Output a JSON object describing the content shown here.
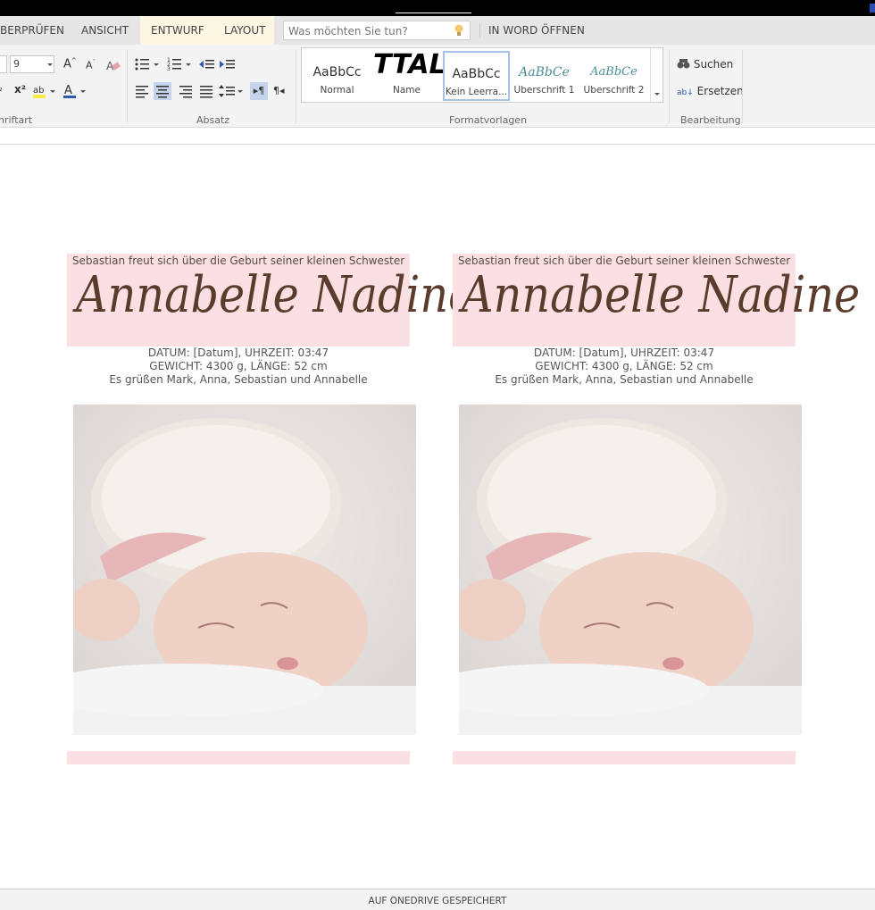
{
  "tabs": {
    "review": "ÜBERPRÜFEN",
    "view": "ANSICHT",
    "design": "ENTWURF",
    "layout": "LAYOUT",
    "open_in_word": "IN WORD ÖFFNEN"
  },
  "tell_me": {
    "placeholder": "Was möchten Sie tun?"
  },
  "ribbon": {
    "font_size": "9",
    "font_group_label": "Schriftart",
    "paragraph_group_label": "Absatz",
    "styles_group_label": "Formatvorlagen",
    "editing_group_label": "Bearbeitung",
    "styles": [
      {
        "preview": "AaBbCc",
        "label": "Normal"
      },
      {
        "preview": "TTAL",
        "label": "Name"
      },
      {
        "preview": "AaBbCc",
        "label": "Kein Leerra..."
      },
      {
        "preview": "AaBbCe",
        "label": "Überschrift 1"
      },
      {
        "preview": "AaBbCe",
        "label": "Überschrift 2"
      }
    ],
    "find_label": "Suchen",
    "replace_label": "Ersetzen",
    "font_group_partial": "hriftart",
    "review_partial": "BERPRÜFEN"
  },
  "cards": [
    {
      "tagline": "Sebastian freut sich über die Geburt seiner kleinen Schwester",
      "name": "Annabelle Nadine",
      "line1": "DATUM: [Datum], UHRZEIT: 03:47",
      "line2": "GEWICHT: 4300 g, LÄNGE: 52 cm",
      "line3": "Es grüßen Mark, Anna, Sebastian und Annabelle"
    },
    {
      "tagline": "Sebastian freut sich über die Geburt seiner kleinen Schwester",
      "name": "Annabelle Nadine",
      "line1": "DATUM: [Datum], UHRZEIT: 03:47",
      "line2": "GEWICHT: 4300 g, LÄNGE: 52 cm",
      "line3": "Es grüßen Mark, Anna, Sebastian und Annabelle"
    }
  ],
  "status": {
    "saved": "AUF ONEDRIVE GESPEICHERT"
  },
  "colors": {
    "accent_pink": "#fbe0e3",
    "name_brown": "#5b3c2c",
    "active_tab": "#fdf6e2",
    "selected_style": "#a9c1e8"
  }
}
